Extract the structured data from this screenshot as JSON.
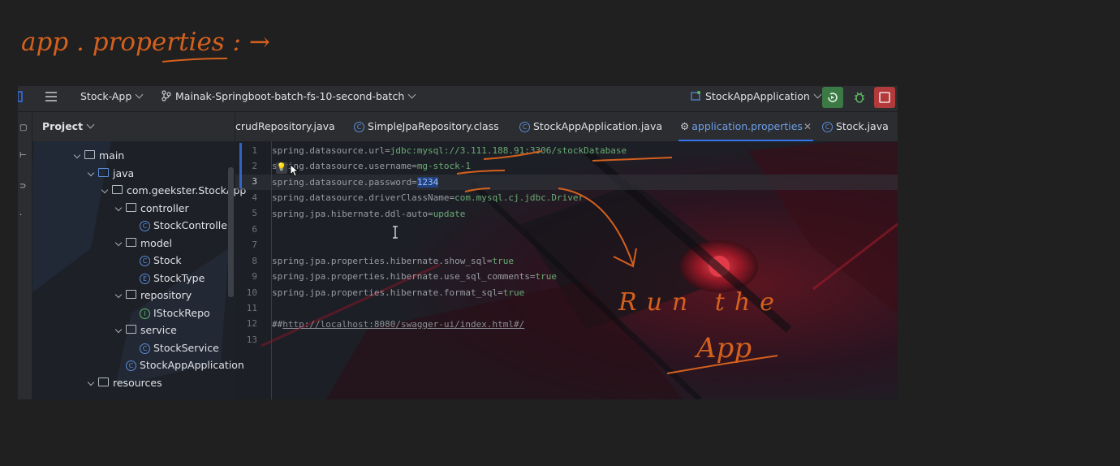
{
  "toolbar": {
    "project_name": "Stock-App",
    "branch": "Mainak-Springboot-batch-fs-10-second-batch",
    "run_config": "StockAppApplication"
  },
  "project_panel": {
    "title": "Project",
    "tree": [
      {
        "label": "main",
        "kind": "folder"
      },
      {
        "label": "java",
        "kind": "source-folder"
      },
      {
        "label": "com.geekster.StockApp",
        "kind": "package"
      },
      {
        "label": "controller",
        "kind": "package"
      },
      {
        "label": "StockController",
        "kind": "class"
      },
      {
        "label": "model",
        "kind": "package"
      },
      {
        "label": "Stock",
        "kind": "class"
      },
      {
        "label": "StockType",
        "kind": "enum"
      },
      {
        "label": "repository",
        "kind": "package"
      },
      {
        "label": "IStockRepo",
        "kind": "interface"
      },
      {
        "label": "service",
        "kind": "package"
      },
      {
        "label": "StockService",
        "kind": "class"
      },
      {
        "label": "StockAppApplication",
        "kind": "class"
      },
      {
        "label": "resources",
        "kind": "folder"
      }
    ]
  },
  "tabs": [
    {
      "label": "crudRepository.java"
    },
    {
      "label": "SimpleJpaRepository.class"
    },
    {
      "label": "StockAppApplication.java"
    },
    {
      "label": "application.properties",
      "active": true
    },
    {
      "label": "Stock.java"
    }
  ],
  "editor": {
    "line_numbers": [
      "1",
      "2",
      "3",
      "4",
      "5",
      "6",
      "7",
      "8",
      "9",
      "10",
      "11",
      "12",
      "13"
    ],
    "lines": [
      {
        "key": "spring.datasource.url=",
        "value": "jdbc:mysql://3.111.188.91:3306/stockDatabase"
      },
      {
        "key": "spring.datasource.username=",
        "value": "mg-stock-1"
      },
      {
        "key": "spring.datasource.password=",
        "value": "1234"
      },
      {
        "key": "spring.datasource.driverClassName=",
        "value": "com.mysql.cj.jdbc.Driver"
      },
      {
        "key": "spring.jpa.hibernate.ddl-auto=",
        "value": "update"
      },
      {
        "key": "",
        "value": ""
      },
      {
        "key": "",
        "value": ""
      },
      {
        "key": "spring.jpa.properties.hibernate.show_sql=",
        "value": "true"
      },
      {
        "key": "spring.jpa.properties.hibernate.use_sql_comments=",
        "value": "true"
      },
      {
        "key": "spring.jpa.properties.hibernate.format_sql=",
        "value": "true"
      },
      {
        "key": "",
        "value": ""
      },
      {
        "key": "##",
        "value": "http://localhost:8080/swagger-ui/index.html#/"
      },
      {
        "key": "",
        "value": ""
      }
    ]
  },
  "annotations": {
    "heading": "app . properties : →",
    "note_line1": "Run the",
    "note_line2": "App"
  },
  "colors": {
    "ink": "#d4601e",
    "accent": "#3574f0",
    "value_green": "#6aab73"
  }
}
